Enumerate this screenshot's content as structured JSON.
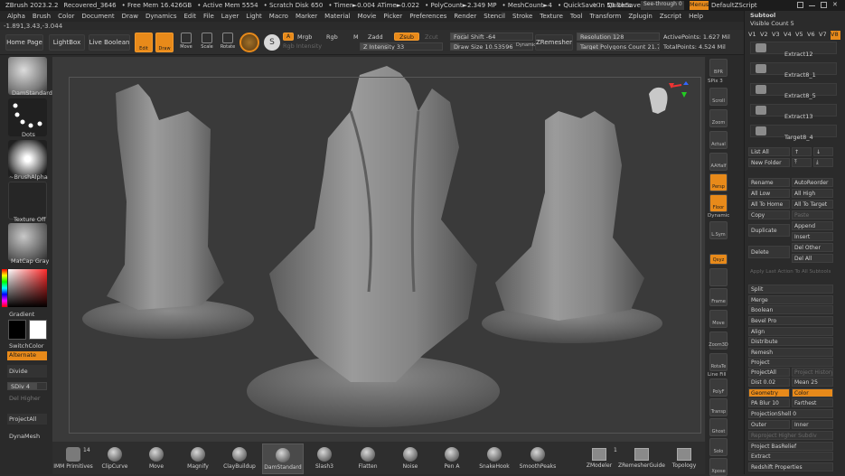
{
  "titlebar": {
    "items": [
      "ZBrush 2023.2.2",
      "Recovered_3646",
      "• Free Mem 16.426GB",
      "• Active Mem 5554",
      "• Scratch Disk 650",
      "• Timer►0.004 ATime►0.022",
      "• PolyCount►2.349 MP",
      "• MeshCount►4",
      "• QuickSave In 59 Secs"
    ],
    "ac": "AC",
    "quicksave": "QuickSave",
    "seethrough": "See-through  0",
    "menus": "Menus",
    "script": "DefaultZScript"
  },
  "menubar": {
    "items": [
      "Alpha",
      "Brush",
      "Color",
      "Document",
      "Draw",
      "Dynamics",
      "Edit",
      "File",
      "Layer",
      "Light",
      "Macro",
      "Marker",
      "Material",
      "Movie",
      "Picker",
      "Preferences",
      "Render",
      "Stencil",
      "Stroke",
      "Texture",
      "Tool",
      "Transform",
      "Zplugin",
      "Zscript",
      "Help"
    ]
  },
  "coords": "-1.891,3.43,-3.044",
  "topshelf": {
    "home": "Home Page",
    "lightbox": "LightBox",
    "liveboolean": "Live Boolean",
    "edit": "Edit",
    "draw": "Draw",
    "move": "Move",
    "scale": "Scale",
    "rotate": "Rotate",
    "a": "A",
    "mrgb": "Mrgb",
    "rgb": "Rgb",
    "m": "M",
    "zadd": "Zadd",
    "zsub": "Zsub",
    "zcut": "Zcut",
    "rgb_intensity": "Rgb Intensity",
    "z_intensity": "Z Intensity 33",
    "z_intensity_value": 33,
    "focal_shift": "Focal Shift -64",
    "focal_shift_value": -64,
    "draw_size": "Draw Size 10.53596",
    "draw_size_value": 10.53596,
    "dynamic": "Dynamic",
    "zremesher": "ZRemesher",
    "resolution": "Resolution 128",
    "resolution_value": 128,
    "target_polygons": "Target Polygons Count 21.74896",
    "active_points": "ActivePoints: 1.627 Mil",
    "total_points": "TotalPoints: 4.524 Mil"
  },
  "leftpanel": {
    "brush_name": "DamStandard",
    "stroke_name": "Dots",
    "alpha_name": "~BrushAlpha",
    "texture_name": "Texture Off",
    "material_name": "MatCap Gray",
    "gradient": "Gradient",
    "switchcolor": "SwitchColor",
    "alternate": "Alternate",
    "divide": "Divide",
    "sdiv": "SDiv 4",
    "del_higher": "Del Higher",
    "projectall": "ProjectAll",
    "dynamesh": "DynaMesh"
  },
  "rightcol": {
    "items": [
      "BPR",
      "SPix 3",
      "Scroll",
      "Zoom",
      "Actual",
      "AAHalf",
      "Persp",
      "Floor",
      "Dynamic",
      "L.Sym",
      "Qxyz",
      "",
      "Frame",
      "Move",
      "Zoom3D",
      "RotaTe",
      "Line Fill",
      "PolyF",
      "Transp",
      "Ghost",
      "Solo",
      "Xpose"
    ],
    "spix_value": 3
  },
  "subtool": {
    "title": "Subtool",
    "visible_count": "Visible Count 5",
    "visible_count_value": 5,
    "versions": [
      "V1",
      "V2",
      "V3",
      "V4",
      "V5",
      "V6",
      "V7",
      "V8"
    ],
    "active_version": "V8",
    "items": [
      "Extract12",
      "Extract8_1",
      "Extract8_5",
      "Extract13",
      "Target8_4"
    ],
    "list_all": "List All",
    "new_folder": "New Folder",
    "rename": "Rename",
    "autoreorder": "AutoReorder",
    "all_low": "All Low",
    "all_high": "All High",
    "all_to_home": "All To Home",
    "all_to_target": "All To Target",
    "copy": "Copy",
    "paste": "Paste",
    "duplicate": "Duplicate",
    "append": "Append",
    "insert": "Insert",
    "delete": "Delete",
    "del_other": "Del Other",
    "del_all": "Del All",
    "apply_last": "Apply Last Action To All Subtools",
    "split": "Split",
    "merge": "Merge",
    "boolean": "Boolean",
    "bevel_pro": "Bevel Pro",
    "align": "Align",
    "distribute": "Distribute",
    "remesh": "Remesh",
    "project": "Project",
    "projectall": "ProjectAll",
    "project_history": "Project History",
    "dist": "Dist 0.02",
    "dist_value": 0.02,
    "mean": "Mean 25",
    "mean_value": 25,
    "geometry": "Geometry",
    "color": "Color",
    "pa_blur": "PA Blur 10",
    "pa_blur_value": 10,
    "farthest": "Farthest",
    "projectionshell": "ProjectionShell 0",
    "projectionshell_value": 0,
    "outer": "Outer",
    "inner": "Inner",
    "reproject": "Reproject Higher Subdiv",
    "project_basrelief": "Project BasRelief",
    "extract": "Extract",
    "redshift": "Redshift Properties"
  },
  "bottom": {
    "imm_label": "IMM Primitives",
    "imm_count": "14",
    "brushes": [
      "ClipCurve",
      "Move",
      "Magnify",
      "ClayBuildup",
      "DamStandard",
      "Slash3",
      "Flatten",
      "Noise",
      "Pen A",
      "SnakeHook",
      "SmoothPeaks",
      "ZModeler",
      "ZRemesherGuide",
      "Topology"
    ],
    "selected": "DamStandard",
    "zmodeler_count": "1"
  },
  "colors": {
    "accent": "#e88a1a",
    "background": "#2b2b2b",
    "viewport": "#3a3a3a"
  }
}
